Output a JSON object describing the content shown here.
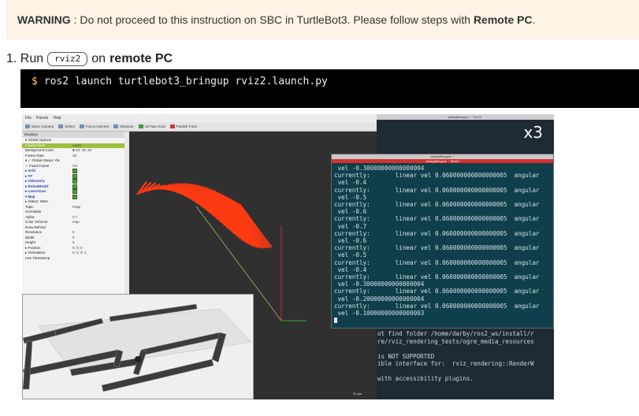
{
  "warning": {
    "label": "WARNING",
    "text_before": " : Do not proceed to this instruction on SBC in TurtleBot3. Please follow steps with ",
    "emphasis": "Remote PC",
    "text_after": "."
  },
  "step": {
    "number": "1. Run",
    "kbd": "rviz2",
    "on": "on",
    "target": "remote PC"
  },
  "code": {
    "prompt": "$",
    "command": "ros2 launch turtlebot3_bringup rviz2.launch.py"
  },
  "screenshot": {
    "rviz": {
      "menu": [
        "File",
        "Panels",
        "Help"
      ],
      "toolbar": [
        "Move Camera",
        "Select",
        "Focus Camera",
        "Measure",
        "2D Nav Goal",
        "Publish Point"
      ],
      "displays_title": "Displays",
      "rows": [
        {
          "k": "▾ Global Options",
          "v": ""
        },
        {
          "k": "Fixed Frame",
          "v": "odom",
          "sel": true
        },
        {
          "k": "Background Color",
          "v": "■ 48; 48; 48"
        },
        {
          "k": "Frame Rate",
          "v": "30"
        },
        {
          "k": "▾ ✓ Global Status: Ok",
          "v": ""
        },
        {
          "k": "✓ Fixed Frame",
          "v": "OK"
        },
        {
          "k": "▸ Grid",
          "v": "",
          "blue": true
        },
        {
          "k": "▸ TF",
          "v": "",
          "blue": true
        },
        {
          "k": "▸ Odometry",
          "v": "",
          "blue": true
        },
        {
          "k": "▸ RobotModel",
          "v": "",
          "blue": true
        },
        {
          "k": "▸ LaserScan",
          "v": "",
          "blue": true
        },
        {
          "k": "▾ Map",
          "v": "",
          "blue": true
        },
        {
          "k": "▸ Status: Warn",
          "v": ""
        },
        {
          "k": "Topic",
          "v": "/map"
        },
        {
          "k": "Unreliable",
          "v": ""
        },
        {
          "k": "Alpha",
          "v": "0.7"
        },
        {
          "k": "Color Scheme",
          "v": "map"
        },
        {
          "k": "Draw Behind",
          "v": ""
        },
        {
          "k": "Resolution",
          "v": "0"
        },
        {
          "k": "Width",
          "v": "0"
        },
        {
          "k": "Height",
          "v": "0"
        },
        {
          "k": "▸ Position",
          "v": "0; 0; 0"
        },
        {
          "k": "▸ Orientation",
          "v": "0; 0; 0; 1"
        },
        {
          "k": "Use Timestamp",
          "v": ""
        }
      ],
      "status": "31 fps"
    },
    "terminal_back": {
      "title": "darby@kingod: ~ 72x19",
      "corner_label": "x3",
      "lines": [
        "ot find folder /home/darby/ros2_ws/install/r",
        "re/rviz_rendering_tests/ogre_media_resources",
        "",
        "is NOT SUPPORTED",
        "ible interface for:  rviz_rendering::RenderW",
        "",
        "with accessibility plugins."
      ]
    },
    "terminal_front": {
      "title": "darby@kingod: ~",
      "subtitle": "darby@kingod: ~ 56x22",
      "lines": [
        " vel -0.30000000000000004",
        "currently:       linear vel 0.060000000000000005  angular",
        " vel -0.4",
        "currently:       linear vel 0.060000000000000005  angular",
        " vel -0.5",
        "currently:       linear vel 0.060000000000000005  angular",
        " vel -0.6",
        "currently:       linear vel 0.060000000000000005  angular",
        " vel -0.7",
        "currently:       linear vel 0.060000000000000005  angular",
        " vel -0.6",
        "currently:       linear vel 0.060000000000000005  angular",
        " vel -0.5",
        "currently:       linear vel 0.060000000000000005  angular",
        " vel -0.4",
        "currently:       linear vel 0.060000000000000005  angular",
        " vel -0.30000000000000004",
        "currently:       linear vel 0.060000000000000005  angular",
        " vel -0.20000000000000004",
        "currently:       linear vel 0.060000000000000005  angular",
        " vel -0.10000000000000003"
      ]
    }
  }
}
